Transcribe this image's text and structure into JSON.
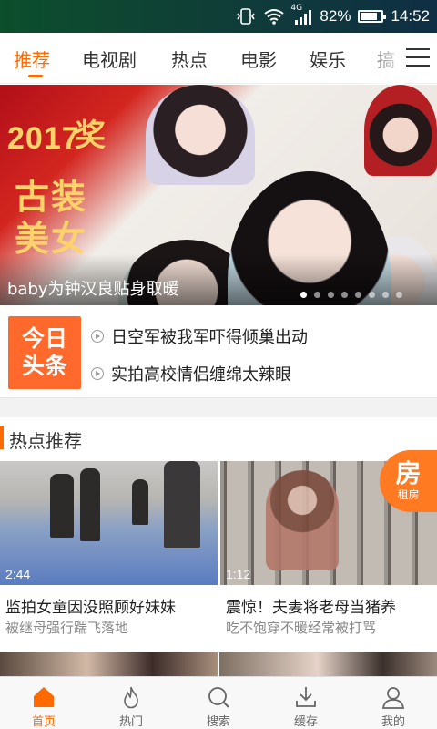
{
  "status_bar": {
    "network": "4G",
    "battery_percent": "82%",
    "battery_level": 0.82,
    "time": "14:52"
  },
  "tabs": [
    {
      "label": "推荐",
      "active": true
    },
    {
      "label": "电视剧",
      "active": false
    },
    {
      "label": "热点",
      "active": false
    },
    {
      "label": "电影",
      "active": false
    },
    {
      "label": "娱乐",
      "active": false
    },
    {
      "label": "搞",
      "active": false
    }
  ],
  "banner": {
    "year_text": "2017",
    "prize_text": "奖",
    "title_line1": "古装",
    "title_line2": "美女",
    "caption": "baby为钟汉良贴身取暖",
    "dot_count": 8,
    "active_dot": 0
  },
  "headlines": {
    "logo_line1": "今日",
    "logo_line2": "头条",
    "items": [
      "日空军被我军吓得倾巢出动",
      "实拍高校情侣缠绵太辣眼"
    ]
  },
  "section": {
    "title": "热点推荐"
  },
  "cards": [
    {
      "duration": "2:44",
      "title": "监拍女童因没照顾好妹妹",
      "subtitle": "被继母强行踹飞落地"
    },
    {
      "duration": "1:12",
      "title": "震惊！夫妻将老母当猪养",
      "subtitle": "吃不饱穿不暖经常被打骂"
    }
  ],
  "fang_badge": {
    "big": "房",
    "small": "租房"
  },
  "bottom_nav": [
    {
      "label": "首页",
      "icon": "home-icon",
      "active": true
    },
    {
      "label": "热门",
      "icon": "flame-icon",
      "active": false
    },
    {
      "label": "搜索",
      "icon": "search-icon",
      "active": false
    },
    {
      "label": "缓存",
      "icon": "download-icon",
      "active": false
    },
    {
      "label": "我的",
      "icon": "user-icon",
      "active": false
    }
  ],
  "colors": {
    "accent": "#ff6a00",
    "logo": "#ff6a2c"
  }
}
